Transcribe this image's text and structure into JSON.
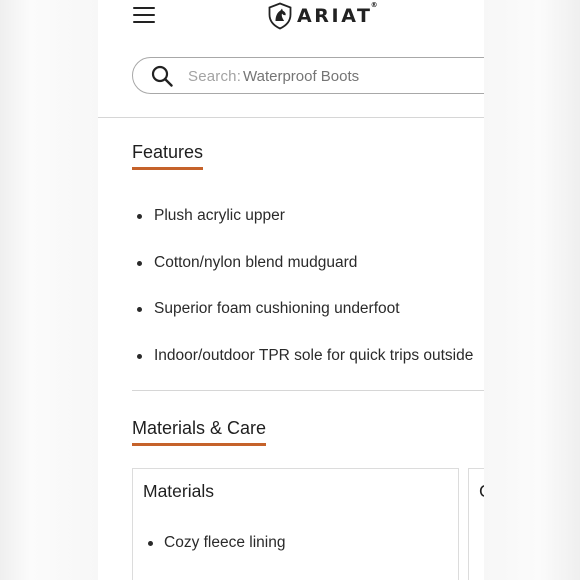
{
  "header": {
    "brand": "ARIAT",
    "trademark": "®",
    "menu_icon": "hamburger-menu-icon",
    "logo_icon": "ariat-horse-emblem"
  },
  "search": {
    "label": "Search:",
    "placeholder": "Waterproof Boots",
    "icon": "search-icon"
  },
  "features": {
    "heading": "Features",
    "items": [
      "Plush acrylic upper",
      "Cotton/nylon blend mudguard",
      "Superior foam cushioning underfoot",
      "Indoor/outdoor TPR sole for quick trips outside"
    ]
  },
  "materials_care": {
    "heading": "Materials & Care",
    "cards": [
      {
        "title": "Materials",
        "items": [
          "Cozy fleece lining"
        ]
      },
      {
        "title": "C"
      }
    ]
  },
  "colors": {
    "accent_underline": "#c5622a",
    "text": "#2d2d2d",
    "border": "#a8a8a8"
  }
}
